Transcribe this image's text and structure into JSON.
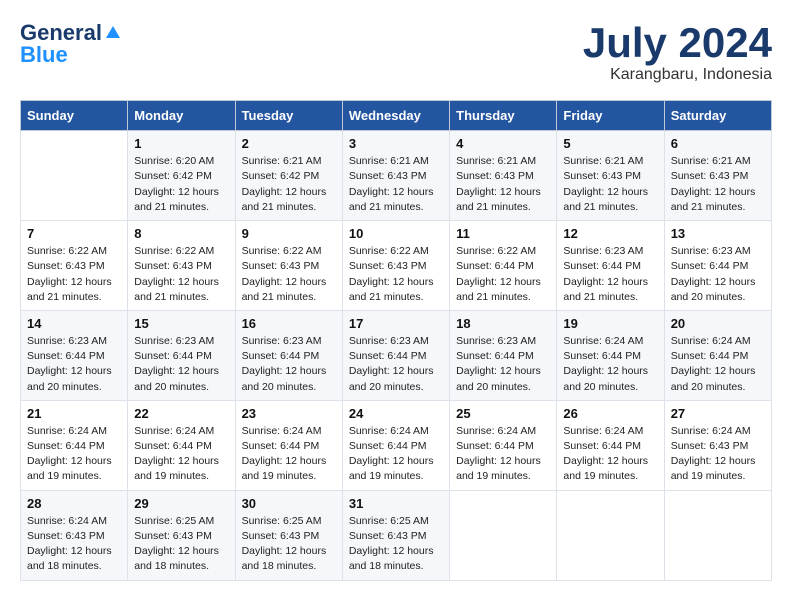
{
  "logo": {
    "line1": "General",
    "line2": "Blue"
  },
  "title": "July 2024",
  "location": "Karangbaru, Indonesia",
  "weekdays": [
    "Sunday",
    "Monday",
    "Tuesday",
    "Wednesday",
    "Thursday",
    "Friday",
    "Saturday"
  ],
  "weeks": [
    [
      {
        "day": "",
        "info": ""
      },
      {
        "day": "1",
        "info": "Sunrise: 6:20 AM\nSunset: 6:42 PM\nDaylight: 12 hours\nand 21 minutes."
      },
      {
        "day": "2",
        "info": "Sunrise: 6:21 AM\nSunset: 6:42 PM\nDaylight: 12 hours\nand 21 minutes."
      },
      {
        "day": "3",
        "info": "Sunrise: 6:21 AM\nSunset: 6:43 PM\nDaylight: 12 hours\nand 21 minutes."
      },
      {
        "day": "4",
        "info": "Sunrise: 6:21 AM\nSunset: 6:43 PM\nDaylight: 12 hours\nand 21 minutes."
      },
      {
        "day": "5",
        "info": "Sunrise: 6:21 AM\nSunset: 6:43 PM\nDaylight: 12 hours\nand 21 minutes."
      },
      {
        "day": "6",
        "info": "Sunrise: 6:21 AM\nSunset: 6:43 PM\nDaylight: 12 hours\nand 21 minutes."
      }
    ],
    [
      {
        "day": "7",
        "info": "Sunrise: 6:22 AM\nSunset: 6:43 PM\nDaylight: 12 hours\nand 21 minutes."
      },
      {
        "day": "8",
        "info": "Sunrise: 6:22 AM\nSunset: 6:43 PM\nDaylight: 12 hours\nand 21 minutes."
      },
      {
        "day": "9",
        "info": "Sunrise: 6:22 AM\nSunset: 6:43 PM\nDaylight: 12 hours\nand 21 minutes."
      },
      {
        "day": "10",
        "info": "Sunrise: 6:22 AM\nSunset: 6:43 PM\nDaylight: 12 hours\nand 21 minutes."
      },
      {
        "day": "11",
        "info": "Sunrise: 6:22 AM\nSunset: 6:44 PM\nDaylight: 12 hours\nand 21 minutes."
      },
      {
        "day": "12",
        "info": "Sunrise: 6:23 AM\nSunset: 6:44 PM\nDaylight: 12 hours\nand 21 minutes."
      },
      {
        "day": "13",
        "info": "Sunrise: 6:23 AM\nSunset: 6:44 PM\nDaylight: 12 hours\nand 20 minutes."
      }
    ],
    [
      {
        "day": "14",
        "info": "Sunrise: 6:23 AM\nSunset: 6:44 PM\nDaylight: 12 hours\nand 20 minutes."
      },
      {
        "day": "15",
        "info": "Sunrise: 6:23 AM\nSunset: 6:44 PM\nDaylight: 12 hours\nand 20 minutes."
      },
      {
        "day": "16",
        "info": "Sunrise: 6:23 AM\nSunset: 6:44 PM\nDaylight: 12 hours\nand 20 minutes."
      },
      {
        "day": "17",
        "info": "Sunrise: 6:23 AM\nSunset: 6:44 PM\nDaylight: 12 hours\nand 20 minutes."
      },
      {
        "day": "18",
        "info": "Sunrise: 6:23 AM\nSunset: 6:44 PM\nDaylight: 12 hours\nand 20 minutes."
      },
      {
        "day": "19",
        "info": "Sunrise: 6:24 AM\nSunset: 6:44 PM\nDaylight: 12 hours\nand 20 minutes."
      },
      {
        "day": "20",
        "info": "Sunrise: 6:24 AM\nSunset: 6:44 PM\nDaylight: 12 hours\nand 20 minutes."
      }
    ],
    [
      {
        "day": "21",
        "info": "Sunrise: 6:24 AM\nSunset: 6:44 PM\nDaylight: 12 hours\nand 19 minutes."
      },
      {
        "day": "22",
        "info": "Sunrise: 6:24 AM\nSunset: 6:44 PM\nDaylight: 12 hours\nand 19 minutes."
      },
      {
        "day": "23",
        "info": "Sunrise: 6:24 AM\nSunset: 6:44 PM\nDaylight: 12 hours\nand 19 minutes."
      },
      {
        "day": "24",
        "info": "Sunrise: 6:24 AM\nSunset: 6:44 PM\nDaylight: 12 hours\nand 19 minutes."
      },
      {
        "day": "25",
        "info": "Sunrise: 6:24 AM\nSunset: 6:44 PM\nDaylight: 12 hours\nand 19 minutes."
      },
      {
        "day": "26",
        "info": "Sunrise: 6:24 AM\nSunset: 6:44 PM\nDaylight: 12 hours\nand 19 minutes."
      },
      {
        "day": "27",
        "info": "Sunrise: 6:24 AM\nSunset: 6:43 PM\nDaylight: 12 hours\nand 19 minutes."
      }
    ],
    [
      {
        "day": "28",
        "info": "Sunrise: 6:24 AM\nSunset: 6:43 PM\nDaylight: 12 hours\nand 18 minutes."
      },
      {
        "day": "29",
        "info": "Sunrise: 6:25 AM\nSunset: 6:43 PM\nDaylight: 12 hours\nand 18 minutes."
      },
      {
        "day": "30",
        "info": "Sunrise: 6:25 AM\nSunset: 6:43 PM\nDaylight: 12 hours\nand 18 minutes."
      },
      {
        "day": "31",
        "info": "Sunrise: 6:25 AM\nSunset: 6:43 PM\nDaylight: 12 hours\nand 18 minutes."
      },
      {
        "day": "",
        "info": ""
      },
      {
        "day": "",
        "info": ""
      },
      {
        "day": "",
        "info": ""
      }
    ]
  ]
}
